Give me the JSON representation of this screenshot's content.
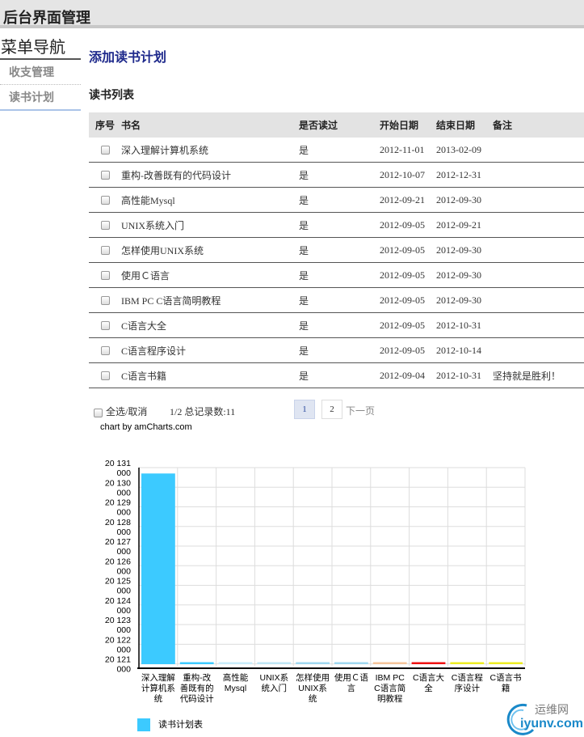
{
  "header": {
    "title": "后台界面管理"
  },
  "sidebar": {
    "title": "菜单导航",
    "items": [
      {
        "label": "收支管理"
      },
      {
        "label": "读书计划"
      }
    ]
  },
  "main": {
    "heading": "添加读书计划",
    "section_title": "读书列表"
  },
  "table": {
    "columns": [
      "序号",
      "书名",
      "是否读过",
      "开始日期",
      "结束日期",
      "备注"
    ],
    "rows": [
      {
        "title": "深入理解计算机系统",
        "read": "是",
        "start": "2012-11-01",
        "end": "2013-02-09",
        "note": ""
      },
      {
        "title": "重构-改善既有的代码设计",
        "read": "是",
        "start": "2012-10-07",
        "end": "2012-12-31",
        "note": ""
      },
      {
        "title": "高性能Mysql",
        "read": "是",
        "start": "2012-09-21",
        "end": "2012-09-30",
        "note": ""
      },
      {
        "title": "UNIX系统入门",
        "read": "是",
        "start": "2012-09-05",
        "end": "2012-09-21",
        "note": ""
      },
      {
        "title": "怎样使用UNIX系统",
        "read": "是",
        "start": "2012-09-05",
        "end": "2012-09-30",
        "note": ""
      },
      {
        "title": "使用Ｃ语言",
        "read": "是",
        "start": "2012-09-05",
        "end": "2012-09-30",
        "note": ""
      },
      {
        "title": "IBM PC C语言简明教程",
        "read": "是",
        "start": "2012-09-05",
        "end": "2012-09-30",
        "note": ""
      },
      {
        "title": "C语言大全",
        "read": "是",
        "start": "2012-09-05",
        "end": "2012-10-31",
        "note": ""
      },
      {
        "title": "C语言程序设计",
        "read": "是",
        "start": "2012-09-05",
        "end": "2012-10-14",
        "note": ""
      },
      {
        "title": "C语言书籍",
        "read": "是",
        "start": "2012-09-04",
        "end": "2012-10-31",
        "note": "坚持就是胜利！"
      }
    ]
  },
  "footer": {
    "select_all": "全选/取消",
    "page_info": "1/2 总记录数:11",
    "pages": [
      "1",
      "2"
    ],
    "next_label": "下一页"
  },
  "chart_credit": "chart by amCharts.com",
  "chart_data": {
    "type": "bar",
    "categories": [
      "深入理解计算机系统",
      "重构-改善既有的代码设计",
      "高性能Mysql",
      "UNIX系统入门",
      "怎样使用UNIX系统",
      "使用Ｃ语言",
      "IBM PC C语言简明教程",
      "C语言大全",
      "C语言程序设计",
      "C语言书籍"
    ],
    "category_labels": [
      [
        "深入理解",
        "计算机系",
        "统"
      ],
      [
        "重构-改",
        "善既有的",
        "代码设计"
      ],
      [
        "高性能",
        "Mysql"
      ],
      [
        "UNIX系",
        "统入门"
      ],
      [
        "怎样使用",
        "UNIX系",
        "统"
      ],
      [
        "使用Ｃ语",
        "言"
      ],
      [
        "IBM PC",
        "C语言简",
        "明教程"
      ],
      [
        "C语言大",
        "全"
      ],
      [
        "C语言程",
        "序设计"
      ],
      [
        "C语言书",
        "籍"
      ]
    ],
    "values": [
      20130700,
      20121000,
      20120930,
      20120921,
      20120930,
      20120930,
      20120930,
      20121031,
      20121014,
      20121031
    ],
    "value_axis_min": 20120900,
    "value_axis_max": 20131000,
    "ylim": [
      20120000,
      20131000
    ],
    "yticks": [
      20121000,
      20122000,
      20123000,
      20124000,
      20125000,
      20126000,
      20127000,
      20128000,
      20129000,
      20130000,
      20131000
    ],
    "ytick_labels": [
      [
        "20 121",
        "000"
      ],
      [
        "20 122",
        "000"
      ],
      [
        "20 123",
        "000"
      ],
      [
        "20 124",
        "000"
      ],
      [
        "20 125",
        "000"
      ],
      [
        "20 126",
        "000"
      ],
      [
        "20 127",
        "000"
      ],
      [
        "20 128",
        "000"
      ],
      [
        "20 129",
        "000"
      ],
      [
        "20 130",
        "000"
      ],
      [
        "20 131",
        "000"
      ]
    ],
    "bar_colors": [
      "#3ccaff",
      "#3ccaff",
      "#c8ecfa",
      "#bfe6f5",
      "#9fd7f0",
      "#9fd7f0",
      "#f5c49a",
      "#ee1111",
      "#ecec22",
      "#ecec22"
    ],
    "grid": true,
    "legend": {
      "label": "读书计划表",
      "color": "#3ccaff",
      "position": "bottom-left"
    }
  },
  "watermark": {
    "top": "运维网",
    "bottom": "iyunv.com"
  }
}
